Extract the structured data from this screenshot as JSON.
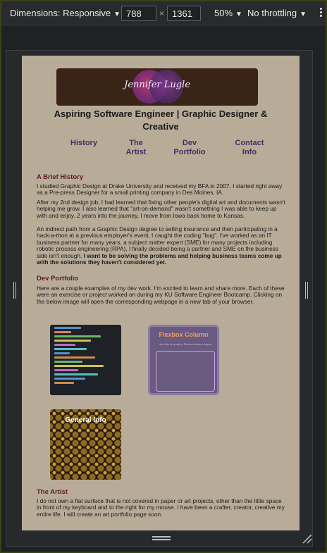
{
  "devtools": {
    "dimensions_label": "Dimensions: Responsive",
    "width_value": "788",
    "height_value": "1361",
    "times_symbol": "×",
    "zoom_label": "50%",
    "throttling_label": "No throttling",
    "caret": "▼"
  },
  "site": {
    "logo_text": "Jennifer Lugle",
    "headline": "Aspiring Software Engineer | Graphic Designer & Creative",
    "nav": [
      {
        "line1": "History",
        "line2": ""
      },
      {
        "line1": "The",
        "line2": "Artist"
      },
      {
        "line1": "Dev",
        "line2": "Portfolio"
      },
      {
        "line1": "Contact",
        "line2": "Info"
      }
    ],
    "history": {
      "title": "A Brief History",
      "p1": "I studied Graphic Design at Drake University and received my BFA in 2007. I started right away as a Pre-press Designer for a small printing company in Des Moines, IA.",
      "p2": "After my 2nd design job, I had learned that fixing other people's digital art and documents wasn't helping me grow. I also learned that \"art-on-demand\" wasn't something I was able to keep up with and enjoy. 2 years into the journey, I move from Iowa back home to Kansas.",
      "p3_plain": "An indirect path from a Graphic Design degree to selling insurance and then participating in a hack-a-thon at a previous employer's event, I caught the coding \"bug\". I've worked as an IT business partner for many years, a subject matter expert (SME) for many projects including robotic process engineering (RPA), I finally decided being a partner and SME on the business side isn't enough.",
      "p3_bold": "I want to be solving the problems and helping business teams come up with the solutions they haven't considered yet."
    },
    "portfolio": {
      "title": "Dev Portfolio",
      "intro": "Here are a couple examples of my dev work. I'm excited to learn and share more. Each of these were an exercise or project worked on during my KU Software Engineer Bootcamp. Clicking on the below image will open the corresponding webpage in a new tab of your browser.",
      "flexbox_title": "Flexbox Column",
      "flexbox_sub": "Use this to create a Flexbox column layout",
      "general_info_title": "General Info"
    },
    "artist": {
      "title": "The Artist",
      "p1": "I do not own a flat surface that is not covered in paper or art projects, other than the little space in front of my keyboard and to the right for my mouse. I have been a crafter, creator, creative my entire life. I will create an art portfolio page soon."
    }
  }
}
